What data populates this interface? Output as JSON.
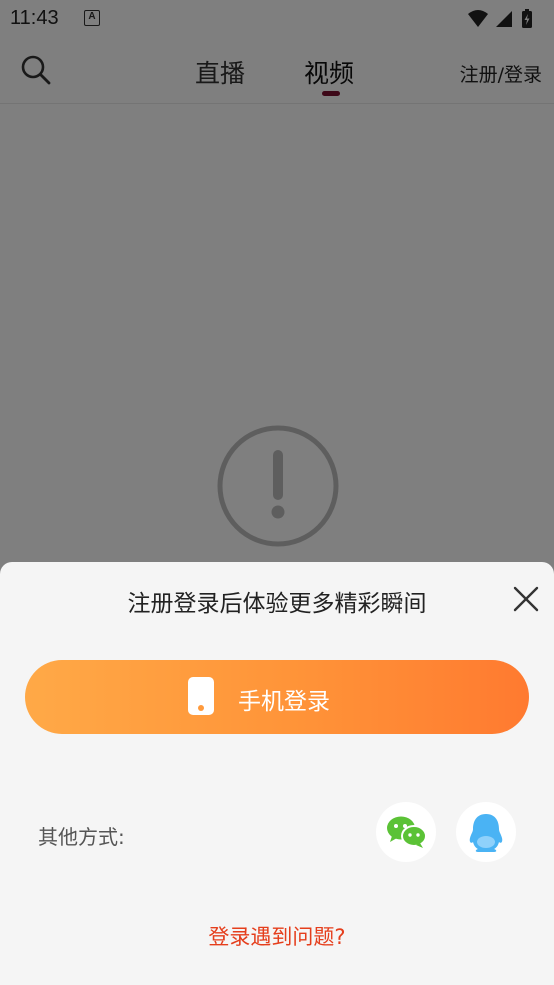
{
  "status_bar": {
    "time": "11:43",
    "notification_icon": "A",
    "icons": [
      "wifi-icon",
      "signal-icon",
      "battery-charging-icon"
    ]
  },
  "nav": {
    "search_icon": "search-icon",
    "tabs": [
      {
        "label": "直播",
        "active": false
      },
      {
        "label": "视频",
        "active": true
      }
    ],
    "register_login": "注册/登录",
    "accent_color": "#7a1030"
  },
  "content": {
    "error_icon": "exclamation-circle-icon"
  },
  "login_sheet": {
    "title": "注册登录后体验更多精彩瞬间",
    "close_icon": "close-icon",
    "phone_login": {
      "label": "手机登录",
      "icon": "phone-icon",
      "gradient": [
        "#ffa947",
        "#ff7a30"
      ]
    },
    "other_methods_label": "其他方式:",
    "social": [
      {
        "name": "wechat",
        "icon": "wechat-icon",
        "color": "#5bc236"
      },
      {
        "name": "qq",
        "icon": "qq-icon",
        "color": "#4ab3f4"
      }
    ],
    "problem_link": "登录遇到问题?",
    "problem_link_color": "#e53e1c"
  }
}
